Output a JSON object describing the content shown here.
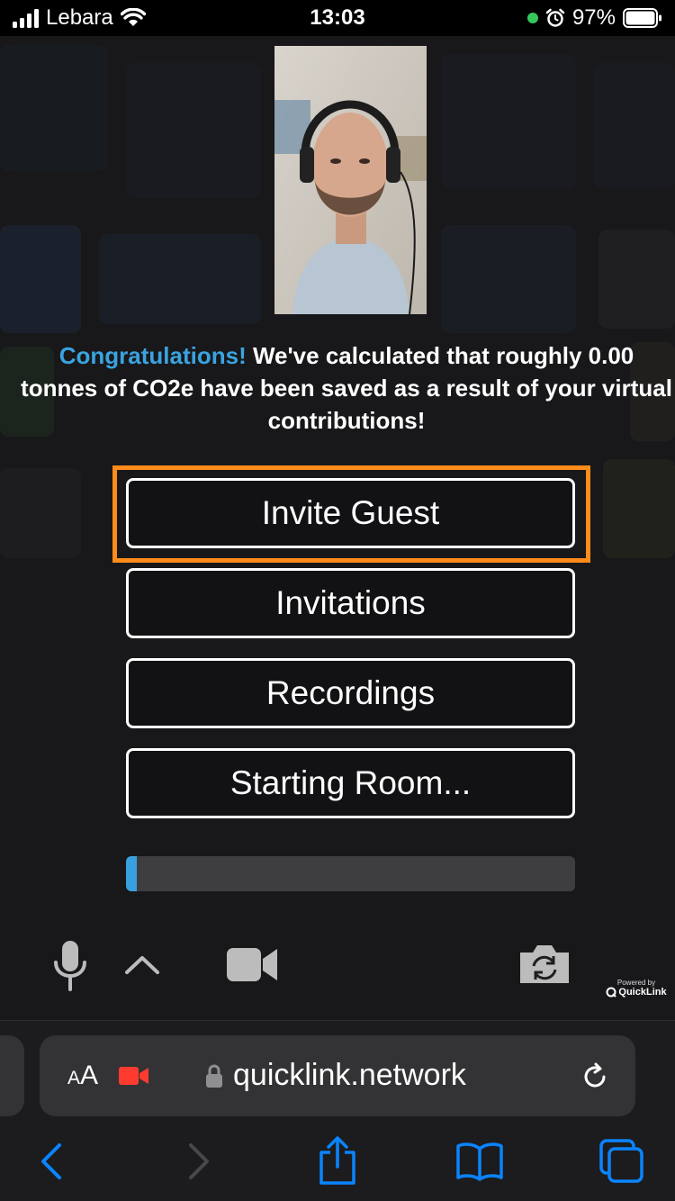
{
  "status_bar": {
    "carrier": "Lebara",
    "time": "13:03",
    "battery": "97%"
  },
  "page": {
    "message": {
      "highlight": "Congratulations!",
      "text": " We've calculated that roughly 0.00 tonnes of CO2e have been saved as a result of your virtual contributions!"
    },
    "buttons": {
      "invite_guest": "Invite Guest",
      "invitations": "Invitations",
      "recordings": "Recordings",
      "starting_room": "Starting Room..."
    },
    "progress_fraction": 0.025,
    "controls": [
      "microphone-icon",
      "chevron-up-icon",
      "video-camera-icon",
      "camera-flip-icon"
    ],
    "branding": {
      "powered_by": "Powered by",
      "brand": "QuickLink"
    }
  },
  "browser": {
    "text_size_label_small": "A",
    "text_size_label_large": "A",
    "url": "quicklink.network",
    "toolbar": [
      "back-icon",
      "forward-icon",
      "share-icon",
      "bookmarks-icon",
      "tabs-icon"
    ]
  },
  "colors": {
    "accent_blue": "#3aa3e0",
    "focus_orange": "#ff8c1a",
    "recording_red": "#ff3b30",
    "link_blue": "#0a84ff"
  }
}
